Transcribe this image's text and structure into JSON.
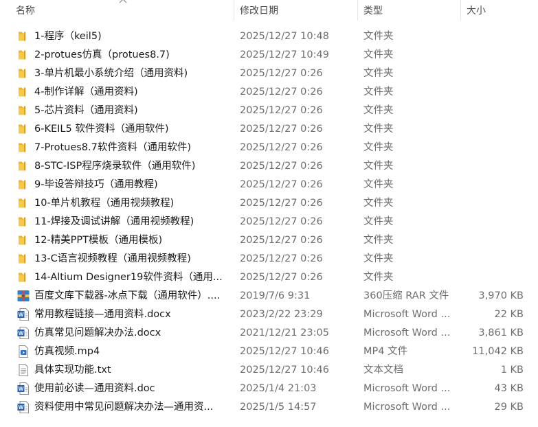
{
  "columns": {
    "name": "名称",
    "date": "修改日期",
    "type": "类型",
    "size": "大小"
  },
  "files": [
    {
      "icon": "folder-icon",
      "name": "1-程序（keil5)",
      "date": "2025/12/27 10:48",
      "type": "文件夹",
      "size": ""
    },
    {
      "icon": "folder-icon",
      "name": "2-protues仿真（protues8.7)",
      "date": "2025/12/27 10:49",
      "type": "文件夹",
      "size": ""
    },
    {
      "icon": "folder-icon",
      "name": "3-单片机最小系统介绍（通用资料)",
      "date": "2025/12/27 0:26",
      "type": "文件夹",
      "size": ""
    },
    {
      "icon": "folder-icon",
      "name": "4-制作详解（通用资料)",
      "date": "2025/12/27 0:26",
      "type": "文件夹",
      "size": ""
    },
    {
      "icon": "folder-icon",
      "name": "5-芯片资料（通用资料)",
      "date": "2025/12/27 0:26",
      "type": "文件夹",
      "size": ""
    },
    {
      "icon": "folder-icon",
      "name": "6-KEIL5 软件资料（通用软件)",
      "date": "2025/12/27 0:26",
      "type": "文件夹",
      "size": ""
    },
    {
      "icon": "folder-icon",
      "name": "7-Protues8.7软件资料（通用软件)",
      "date": "2025/12/27 0:26",
      "type": "文件夹",
      "size": ""
    },
    {
      "icon": "folder-icon",
      "name": "8-STC-ISP程序烧录软件（通用软件)",
      "date": "2025/12/27 0:26",
      "type": "文件夹",
      "size": ""
    },
    {
      "icon": "folder-icon",
      "name": "9-毕设答辩技巧（通用教程)",
      "date": "2025/12/27 0:26",
      "type": "文件夹",
      "size": ""
    },
    {
      "icon": "folder-icon",
      "name": "10-单片机教程（通用视频教程)",
      "date": "2025/12/27 0:26",
      "type": "文件夹",
      "size": ""
    },
    {
      "icon": "folder-icon",
      "name": "11-焊接及调试讲解（通用视频教程)",
      "date": "2025/12/27 0:26",
      "type": "文件夹",
      "size": ""
    },
    {
      "icon": "folder-icon",
      "name": "12-精美PPT模板（通用模板)",
      "date": "2025/12/27 0:26",
      "type": "文件夹",
      "size": ""
    },
    {
      "icon": "folder-icon",
      "name": "13-C语言视频教程（通用视频教程)",
      "date": "2025/12/27 0:26",
      "type": "文件夹",
      "size": ""
    },
    {
      "icon": "folder-icon",
      "name": "14-Altium Designer19软件资料（通用...",
      "date": "2025/12/27 0:26",
      "type": "文件夹",
      "size": ""
    },
    {
      "icon": "rar-archive-icon",
      "name": "百度文库下载器-冰点下载（通用软件）....",
      "date": "2019/7/6 9:31",
      "type": "360压缩 RAR 文件",
      "size": "3,970 KB"
    },
    {
      "icon": "word-document-icon",
      "name": "常用教程链接—通用资料.docx",
      "date": "2023/2/22 23:29",
      "type": "Microsoft Word ...",
      "size": "22 KB"
    },
    {
      "icon": "word-document-icon",
      "name": "仿真常见问题解决办法.docx",
      "date": "2021/12/21 23:05",
      "type": "Microsoft Word ...",
      "size": "3,861 KB"
    },
    {
      "icon": "video-file-icon",
      "name": "仿真视频.mp4",
      "date": "2025/12/27 10:46",
      "type": "MP4 文件",
      "size": "11,042 KB"
    },
    {
      "icon": "text-file-icon",
      "name": "具体实现功能.txt",
      "date": "2025/12/27 10:46",
      "type": "文本文档",
      "size": "1 KB"
    },
    {
      "icon": "word-document-icon",
      "name": "使用前必读—通用资料.doc",
      "date": "2025/1/4 21:03",
      "type": "Microsoft Word ...",
      "size": "43 KB"
    },
    {
      "icon": "word-document-icon",
      "name": "资料使用中常见问题解决办法—通用资...",
      "date": "2025/1/5 14:57",
      "type": "Microsoft Word ...",
      "size": "29 KB"
    }
  ]
}
